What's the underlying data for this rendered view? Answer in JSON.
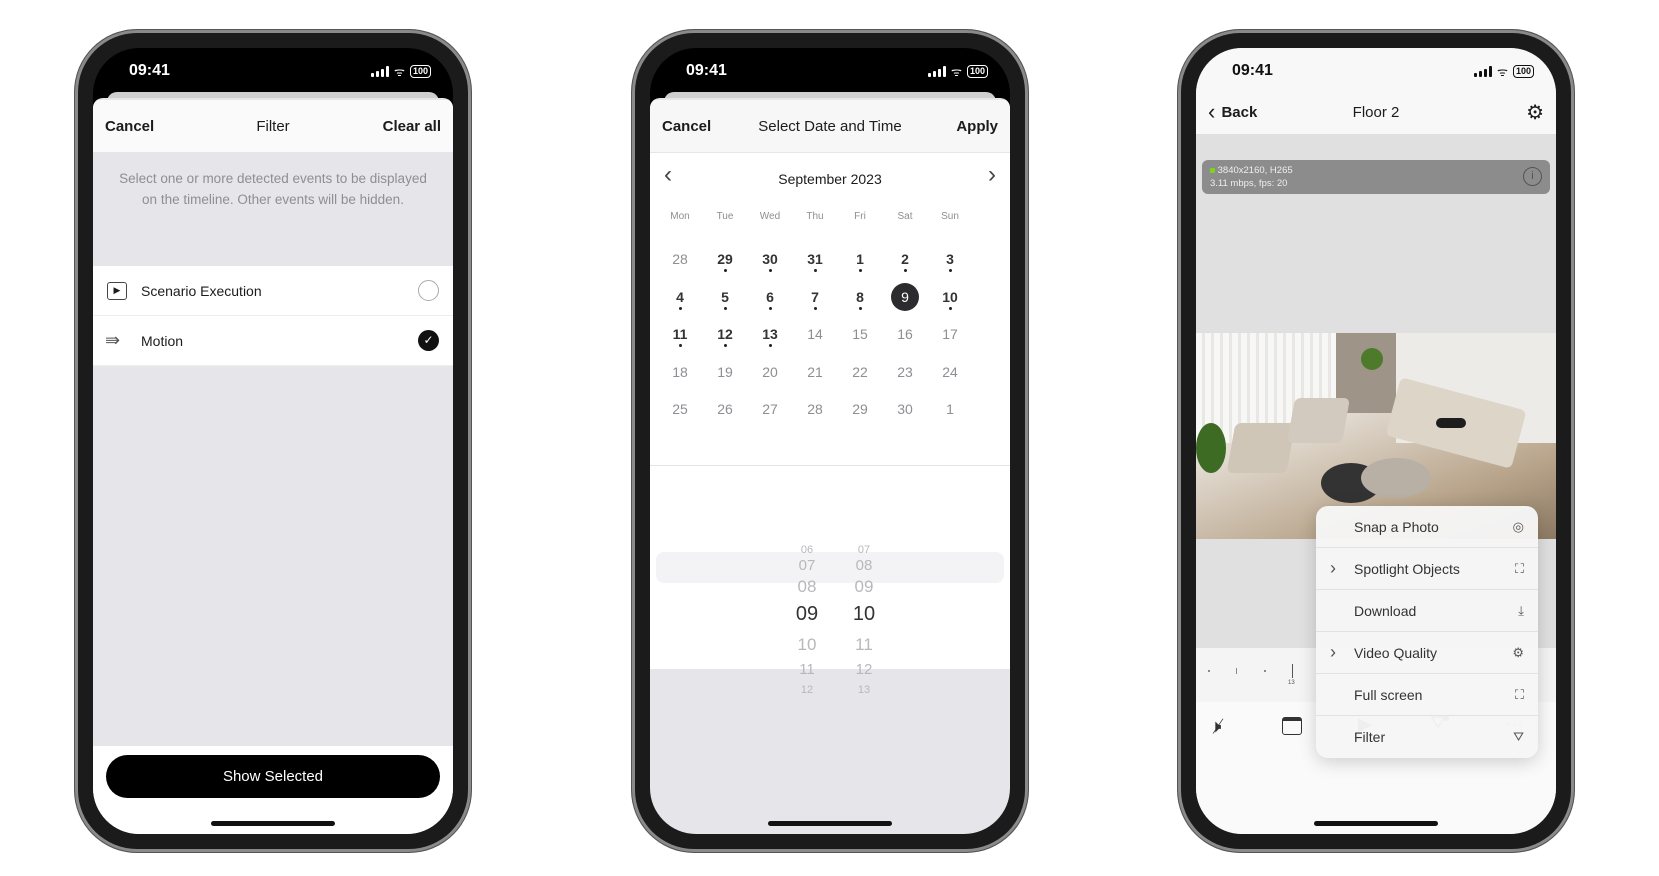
{
  "status": {
    "time": "09:41",
    "battery": "100"
  },
  "filter_screen": {
    "cancel": "Cancel",
    "title": "Filter",
    "clear_all": "Clear all",
    "description": "Select one or more detected events to be displayed on the timeline. Other events will be hidden.",
    "items": [
      {
        "label": "Scenario Execution",
        "icon": "scenario-icon",
        "checked": false
      },
      {
        "label": "Motion",
        "icon": "motion-icon",
        "checked": true
      }
    ],
    "show_selected": "Show Selected"
  },
  "date_screen": {
    "cancel": "Cancel",
    "title": "Select Date and Time",
    "apply": "Apply",
    "month": "September 2023",
    "weekdays": [
      "Mon",
      "Tue",
      "Wed",
      "Thu",
      "Fri",
      "Sat",
      "Sun"
    ],
    "days": [
      [
        "28",
        "29",
        "30",
        "31",
        "1",
        "2",
        "3"
      ],
      [
        "4",
        "5",
        "6",
        "7",
        "8",
        "9",
        "10"
      ],
      [
        "11",
        "12",
        "13",
        "14",
        "15",
        "16",
        "17"
      ],
      [
        "18",
        "19",
        "20",
        "21",
        "22",
        "23",
        "24"
      ],
      [
        "25",
        "26",
        "27",
        "28",
        "29",
        "30",
        "1"
      ]
    ],
    "event_days": [
      "29",
      "30",
      "31",
      "1",
      "2",
      "3",
      "4",
      "5",
      "6",
      "7",
      "8",
      "10",
      "11",
      "12",
      "13"
    ],
    "selected_day": "9",
    "hours": [
      "06",
      "07",
      "08",
      "09",
      "10",
      "11",
      "12"
    ],
    "minutes": [
      "07",
      "08",
      "09",
      "10",
      "11",
      "12",
      "13"
    ],
    "selected_hour": "09",
    "selected_minute": "10"
  },
  "camera_screen": {
    "back": "Back",
    "title": "Floor 2",
    "stream_info_line1": "3840x2160, H265",
    "stream_info_line2": "3.11 mbps, fps: 20",
    "status_color": "#7ed321",
    "timeline_label": "13",
    "menu": [
      {
        "label": "Snap a Photo",
        "icon": "camera-icon",
        "submenu": false
      },
      {
        "label": "Spotlight Objects",
        "icon": "spotlight-icon",
        "submenu": true
      },
      {
        "label": "Download",
        "icon": "download-icon",
        "submenu": false
      },
      {
        "label": "Video Quality",
        "icon": "gear-icon",
        "submenu": true
      },
      {
        "label": "Full screen",
        "icon": "fullscreen-icon",
        "submenu": false
      },
      {
        "label": "Filter",
        "icon": "filter-icon",
        "submenu": false
      }
    ],
    "toolbar": [
      "mute-icon",
      "calendar-icon",
      "play-icon",
      "filter-icon",
      "more-icon"
    ]
  }
}
